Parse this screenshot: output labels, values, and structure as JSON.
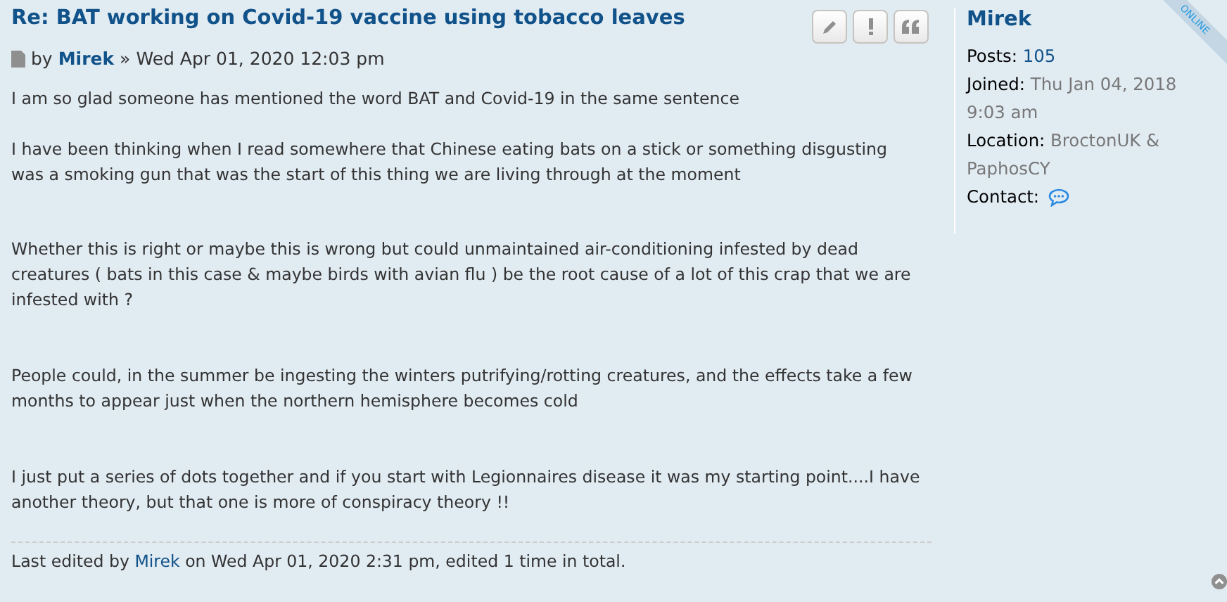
{
  "post": {
    "title": "Re: BAT working on Covid-19 vaccine using tobacco leaves",
    "by": "by",
    "author": "Mirek",
    "separator": "»",
    "date": "Wed Apr 01, 2020 12:03 pm",
    "body": "I am so glad someone has mentioned the word BAT and Covid-19 in the same sentence\n\nI have been thinking when I read somewhere that Chinese eating bats on a stick or something disgusting was a smoking gun that was the start of this thing we are living through at the moment\n\n\nWhether this is right or maybe this is wrong but could unmaintained air-conditioning infested by dead creatures ( bats in this case & maybe birds with avian flu ) be the root cause of a lot of this crap that we are infested with ?\n\n\nPeople could, in the summer be ingesting the winters putrifying/rotting creatures, and the effects take a few months to appear just when the northern hemisphere becomes cold\n\n\nI just put a series of dots together and if you start with Legionnaires disease it was my starting point....I have another theory, but that one is more of conspiracy theory !!",
    "edit_notice": {
      "before": "Last edited by",
      "author": "Mirek",
      "after": "on Wed Apr 01, 2020 2:31 pm, edited 1 time in total."
    }
  },
  "profile": {
    "username": "Mirek",
    "online": true,
    "online_label": "ONLINE",
    "fields": [
      {
        "label": "Posts:",
        "value": "105",
        "kind": "link"
      },
      {
        "label": "Joined:",
        "value": "Thu Jan 04, 2018 9:03 am",
        "kind": "text"
      },
      {
        "label": "Location:",
        "value": "BroctonUK & PaphosCY",
        "kind": "text"
      },
      {
        "label": "Contact:",
        "kind": "icon"
      }
    ]
  }
}
